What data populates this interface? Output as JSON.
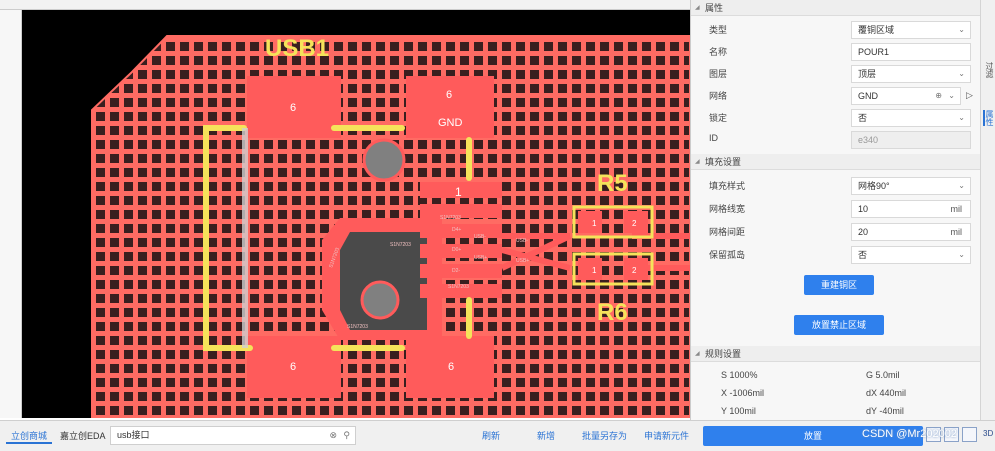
{
  "colors": {
    "board": "#ff6b63",
    "board_bg": "#000000",
    "silk": "#f5e35a",
    "pad": "#ff5b5b",
    "via": "#9a9a9a",
    "accent": "#2f80ed"
  },
  "pcb": {
    "designators": [
      "USB1",
      "R5",
      "R6"
    ],
    "pads": [
      "6",
      "6",
      "GND",
      "6",
      "6"
    ],
    "pin1_label": "1",
    "small_labels": [
      "S1N7203",
      "S1N7203",
      "S1N7203",
      "S1N7203",
      "S1N7203",
      "D4+",
      "USB-",
      "D0+",
      "USB+",
      "USB-",
      "D2-",
      "USB+"
    ],
    "r_pad_labels": [
      "1",
      "2",
      "1",
      "2"
    ]
  },
  "panel": {
    "section_properties": "属性",
    "rows": [
      {
        "label": "类型",
        "value": "覆铜区域"
      },
      {
        "label": "名称",
        "value": "POUR1"
      },
      {
        "label": "图层",
        "value": "顶层"
      },
      {
        "label": "网络",
        "value": "GND"
      },
      {
        "label": "锁定",
        "value": "否"
      },
      {
        "label": "ID",
        "value": "e340"
      }
    ],
    "section_fill": "填充设置",
    "fill_rows": [
      {
        "label": "填充样式",
        "value": "网格90°",
        "unit": ""
      },
      {
        "label": "网格线宽",
        "value": "10",
        "unit": "mil"
      },
      {
        "label": "网格间距",
        "value": "20",
        "unit": "mil"
      },
      {
        "label": "保留孤岛",
        "value": "否",
        "unit": ""
      }
    ],
    "rebuild_button": "重建铜区",
    "keepout_button": "放置禁止区域",
    "section_rules": "规则设置",
    "stats": {
      "s": "S 1000%",
      "x": "X -1006mil",
      "y": "Y 100mil",
      "g": "G 5.0mil",
      "dx": "dX 440mil",
      "dy": "dY -40mil"
    },
    "side_tabs": [
      "过滤",
      "属性"
    ]
  },
  "bottom": {
    "tabs": [
      "立创商城",
      "嘉立创EDA"
    ],
    "search_value": "usb接口",
    "actions": [
      "刷新",
      "新增",
      "批量另存为",
      "申请新元件"
    ],
    "place_button": "放置",
    "watermark": "CSDN @Mr202002",
    "corner_text": "3D"
  }
}
